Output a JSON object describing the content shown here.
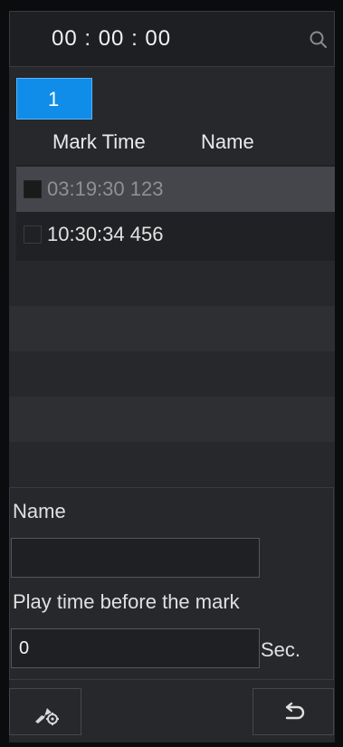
{
  "search": {
    "time_value": "00 :  00 :  00"
  },
  "pagination": {
    "current_page": "1"
  },
  "table": {
    "columns": [
      "Mark Time",
      "Name"
    ],
    "rows": [
      {
        "mark_time": "03:19:30",
        "name": "123",
        "selected": true
      },
      {
        "mark_time": "10:30:34",
        "name": "456",
        "selected": false
      }
    ],
    "row_texts": [
      "03:19:30 123",
      "10:30:34 456"
    ]
  },
  "form": {
    "name_label": "Name",
    "name_value": "",
    "play_before_label": "Play time before the mark",
    "play_before_value": "0",
    "unit_label": "Sec."
  },
  "toolbar": {
    "left_button_icon": "mark-settings-icon",
    "right_button_icon": "back-icon"
  },
  "colors": {
    "accent": "#0f8de8",
    "panel": "#27282c",
    "selected_row": "#45464b"
  }
}
